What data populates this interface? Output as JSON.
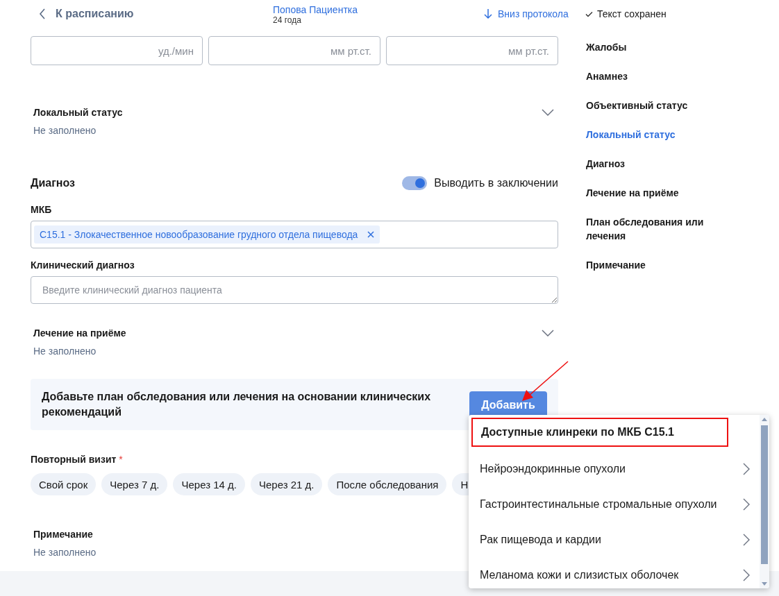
{
  "header": {
    "back": "К расписанию",
    "patient_name": "Попова Пациентка",
    "patient_age": "24 года",
    "scroll_link": "Вниз протокола",
    "save_status": "Текст сохранен"
  },
  "vitals": [
    {
      "placeholder": "уд./мин"
    },
    {
      "placeholder": "мм рт.ст."
    },
    {
      "placeholder": "мм рт.ст."
    }
  ],
  "local_status": {
    "title": "Локальный статус",
    "value": "Не заполнено",
    "expanded": false
  },
  "diagnosis": {
    "title": "Диагноз",
    "toggle": {
      "label": "Выводить в заключении",
      "on": true
    },
    "mkb_label": "МКБ",
    "mkb_tag": "C15.1 - Злокачественное новообразование грудного отдела пищевода",
    "clinical_label": "Клинический диагноз",
    "clinical_placeholder": "Введите клинический диагноз пациента"
  },
  "treatment": {
    "title": "Лечение на приёме",
    "value": "Не заполнено",
    "expanded": false
  },
  "banner": {
    "text": "Добавьте план обследования или лечения на основании клинических рекомендаций",
    "button": "Добавить"
  },
  "revisit": {
    "title": "Повторный визит",
    "required": "*",
    "chips": [
      {
        "label": "Свой срок",
        "selected": false
      },
      {
        "label": "Через 7 д.",
        "selected": false
      },
      {
        "label": "Через 14 д.",
        "selected": false
      },
      {
        "label": "Через 21 д.",
        "selected": false
      },
      {
        "label": "После обследования",
        "selected": false
      },
      {
        "label": "Н",
        "selected": false
      }
    ]
  },
  "note": {
    "title": "Примечание",
    "value": "Не заполнено"
  },
  "nav": [
    {
      "label": "Жалобы",
      "selected": false
    },
    {
      "label": "Анамнез",
      "selected": false
    },
    {
      "label": "Объективный статус",
      "selected": false
    },
    {
      "label": "Локальный статус",
      "selected": true
    },
    {
      "label": "Диагноз",
      "selected": false
    },
    {
      "label": "Лечение на приёме",
      "selected": false
    },
    {
      "label": "План обследования или лечения",
      "selected": false
    },
    {
      "label": "Примечание",
      "selected": false
    }
  ],
  "dropdown": {
    "header": "Доступные клинреки по МКБ C15.1",
    "items": [
      {
        "label": "Нейроэндокринные опухоли"
      },
      {
        "label": "Гастроинтестинальные стромальные опухоли"
      },
      {
        "label": "Рак пищевода и кардии"
      },
      {
        "label": "Меланома кожи и слизистых оболочек"
      }
    ]
  }
}
